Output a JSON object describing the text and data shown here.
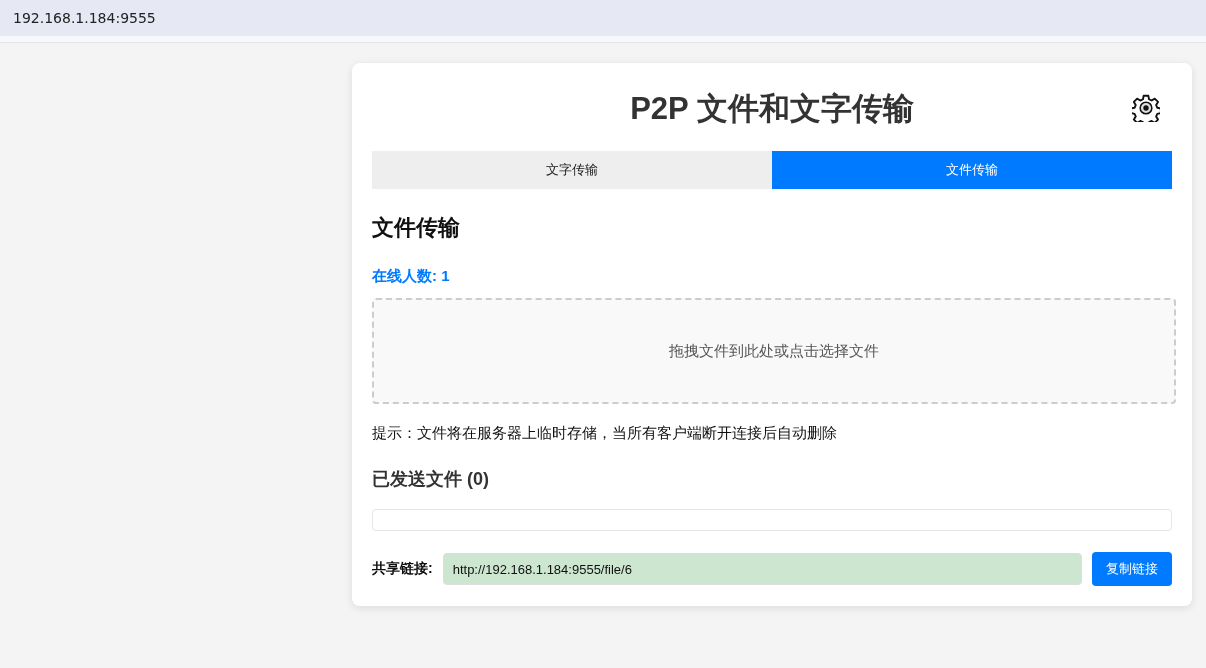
{
  "browser": {
    "address": "192.168.1.184:9555"
  },
  "app": {
    "title": "P2P 文件和文字传输",
    "tabs": [
      {
        "label": "文字传输",
        "selected": false
      },
      {
        "label": "文件传输",
        "selected": true
      }
    ],
    "section_title": "文件传输",
    "online_count": "在线人数: 1",
    "drop_zone": "拖拽文件到此处或点击选择文件",
    "hint": "提示：文件将在服务器上临时存储，当所有客户端断开连接后自动删除",
    "sent_files_title": "已发送文件 (0)",
    "share": {
      "label": "共享链接:",
      "value": "http://192.168.1.184:9555/file/6",
      "button": "复制链接"
    }
  }
}
